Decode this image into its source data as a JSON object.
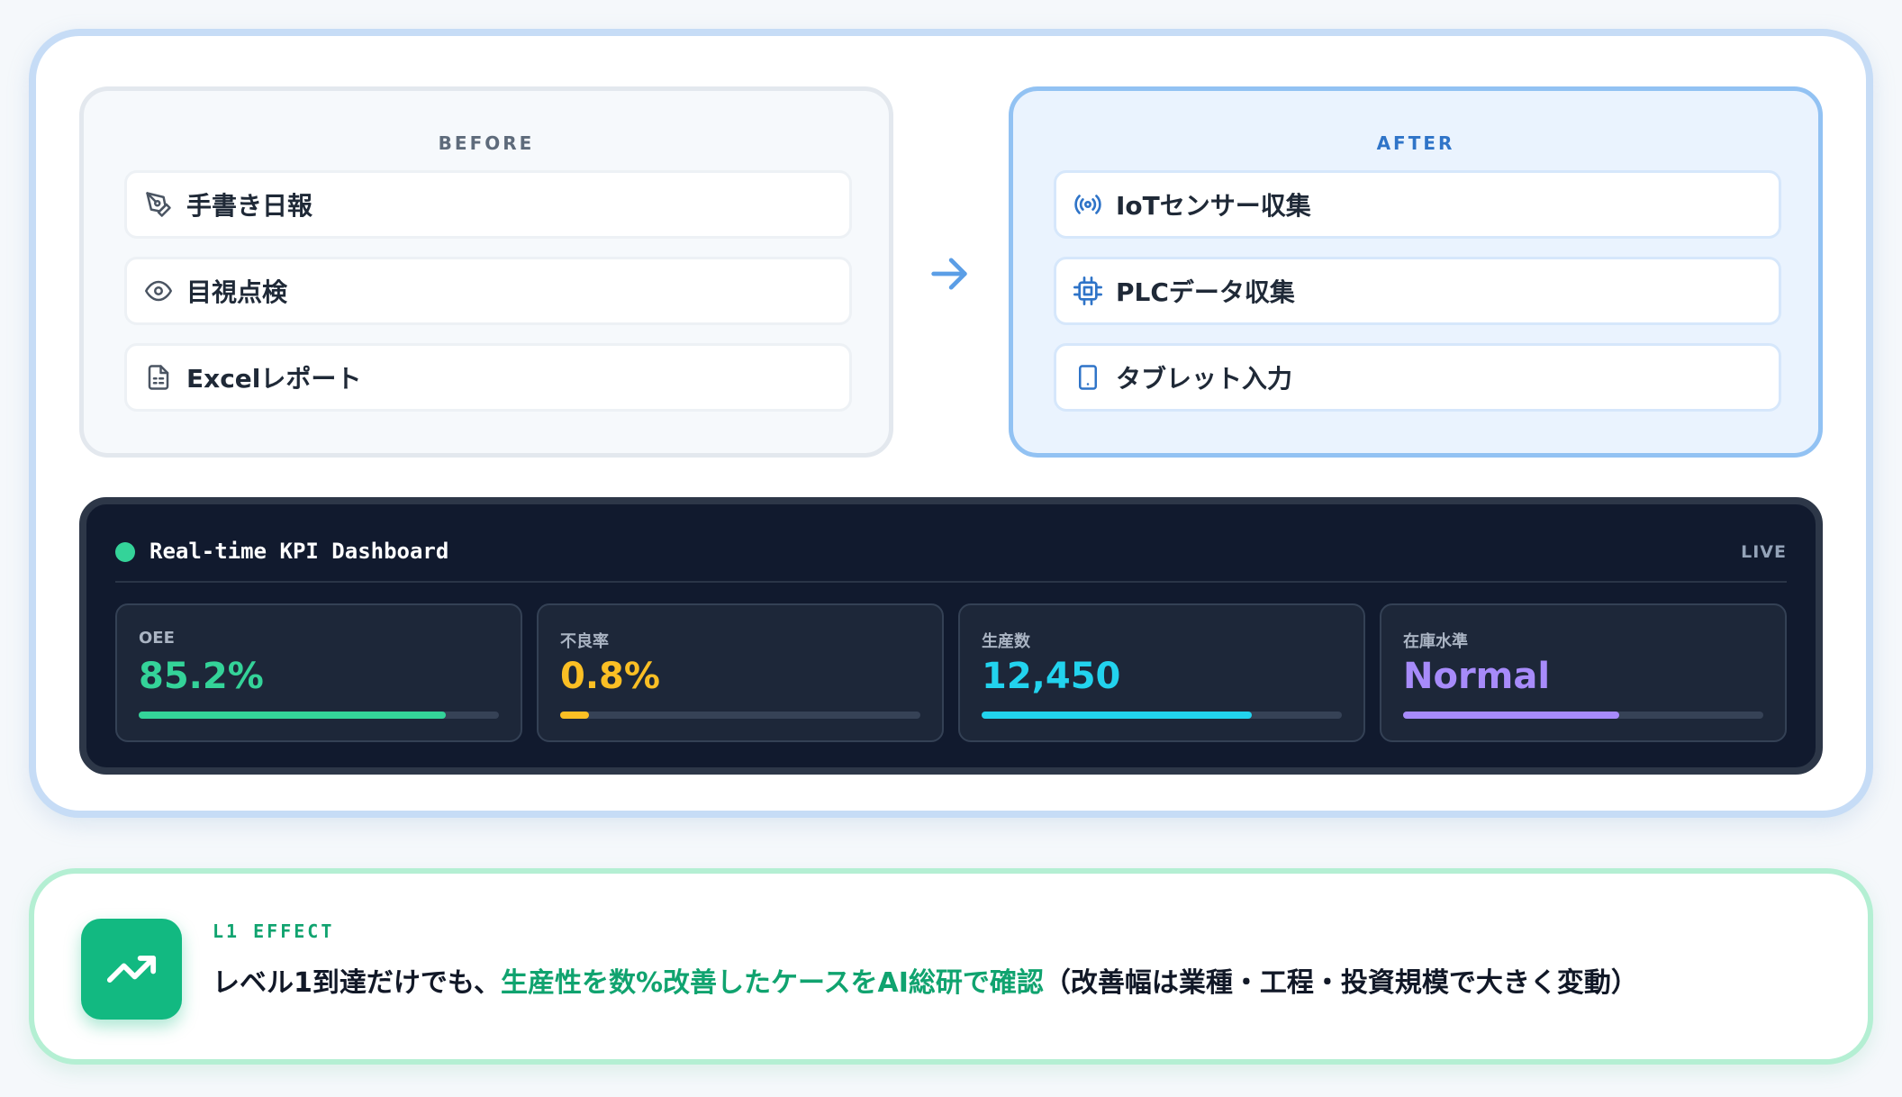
{
  "before": {
    "title": "BEFORE",
    "items": [
      {
        "label": "手書き日報",
        "icon": "pen-icon"
      },
      {
        "label": "目視点検",
        "icon": "eye-icon"
      },
      {
        "label": "Excelレポート",
        "icon": "spreadsheet-file-icon"
      }
    ]
  },
  "after": {
    "title": "AFTER",
    "items": [
      {
        "label": "IoTセンサー収集",
        "icon": "sensor-signal-icon"
      },
      {
        "label": "PLCデータ収集",
        "icon": "chip-icon"
      },
      {
        "label": "タブレット入力",
        "icon": "tablet-icon"
      }
    ]
  },
  "arrow_icon": "arrow-right-icon",
  "dashboard": {
    "title": "Real-time KPI Dashboard",
    "status": "LIVE",
    "kpis": [
      {
        "label": "OEE",
        "value": "85.2%",
        "color": "#34d399",
        "progress": 0.852
      },
      {
        "label": "不良率",
        "value": "0.8%",
        "color": "#fbbf24",
        "progress": 0.08
      },
      {
        "label": "生産数",
        "value": "12,450",
        "color": "#22d3ee",
        "progress": 0.75
      },
      {
        "label": "在庫水準",
        "value": "Normal",
        "color": "#a78bfa",
        "progress": 0.6
      }
    ]
  },
  "effect": {
    "tag": "L1 EFFECT",
    "icon": "trending-up-icon",
    "text_before": "レベル1到達だけでも、",
    "text_highlight": "生産性を数%改善したケースをAI総研で確認",
    "text_after": "（改善幅は業種・工程・投資規模で大きく変動）"
  },
  "colors": {
    "accent_green": "#10a36f",
    "accent_blue": "#2f74c8",
    "dashboard_bg": "#111a2e"
  }
}
